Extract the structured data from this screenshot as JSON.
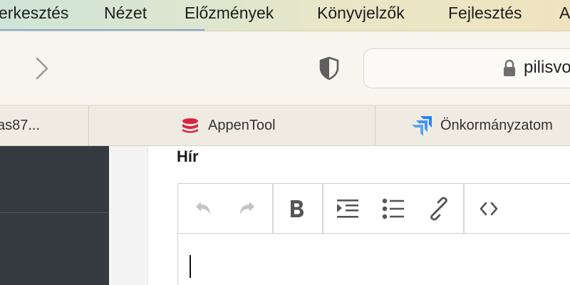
{
  "menubar": {
    "items": [
      "erkesztés",
      "Nézet",
      "Előzmények",
      "Könyvjelzők",
      "Fejlesztés",
      "A"
    ]
  },
  "toolbar": {
    "url": "pilisvo"
  },
  "bookmarks": {
    "items": [
      "as87...",
      "AppenTool",
      "Önkormányzatom"
    ]
  },
  "editor": {
    "label": "Hír",
    "buttons": [
      "undo-icon",
      "redo-icon",
      "bold-icon",
      "indent-icon",
      "bulleted-list-icon",
      "link-icon",
      "source-code-icon"
    ],
    "content": ""
  },
  "colors": {
    "sidebar": "#343a40",
    "icon_gray": "#5f5f5f",
    "jira_blue": "#2684ff",
    "appentool_red": "#d7263d"
  }
}
